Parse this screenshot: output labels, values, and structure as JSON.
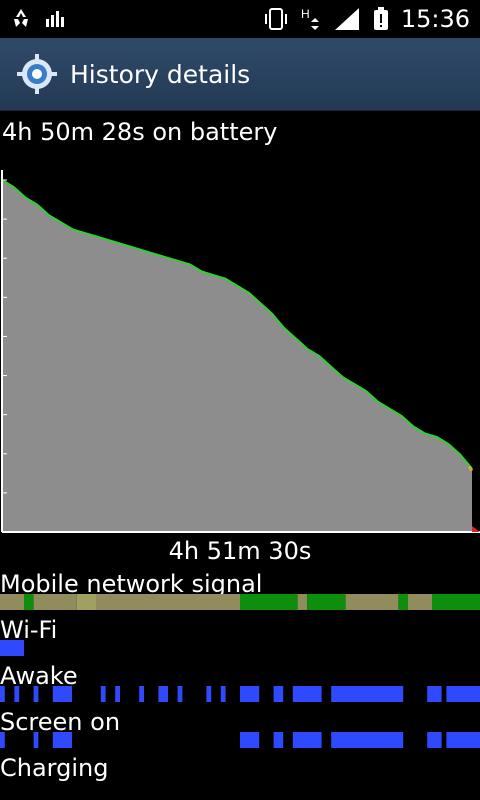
{
  "status_bar": {
    "time": "15:36",
    "left_icons": [
      "recycle-icon",
      "bar-chart-icon"
    ],
    "right_icons": [
      "vibrate-icon",
      "data-h-icon",
      "signal-icon",
      "battery-alert-icon"
    ]
  },
  "title_bar": {
    "icon": "gear-icon",
    "title": "History details"
  },
  "battery": {
    "on_battery": "4h 50m 28s on battery",
    "duration": "4h 51m 30s",
    "level_curve": [
      100,
      98,
      95,
      93,
      90,
      88,
      86,
      85,
      84,
      83,
      82,
      81,
      80,
      79,
      78,
      77,
      76,
      74,
      73,
      72,
      70,
      68,
      65,
      62,
      58,
      55,
      52,
      50,
      47,
      44,
      42,
      40,
      37,
      35,
      33,
      30,
      28,
      27,
      25,
      22,
      18
    ],
    "fill_color": "#8d8d8d",
    "line_color": "#2fd12f",
    "end_color": "#d6b021"
  },
  "rows": [
    {
      "label": "Mobile network signal",
      "type": "signal"
    },
    {
      "label": "Wi-Fi",
      "type": "wifi"
    },
    {
      "label": "Awake",
      "type": "awake"
    },
    {
      "label": "Screen on",
      "type": "screen"
    },
    {
      "label": "Charging",
      "type": "charging"
    }
  ],
  "tracks": {
    "signal": [
      {
        "s": 0.0,
        "e": 0.05,
        "c": "#918c5c"
      },
      {
        "s": 0.05,
        "e": 0.07,
        "c": "#0d8f0d"
      },
      {
        "s": 0.07,
        "e": 0.16,
        "c": "#918c5c"
      },
      {
        "s": 0.16,
        "e": 0.2,
        "c": "#a0a060"
      },
      {
        "s": 0.2,
        "e": 0.5,
        "c": "#918c5c"
      },
      {
        "s": 0.5,
        "e": 0.62,
        "c": "#0d8f0d"
      },
      {
        "s": 0.62,
        "e": 0.64,
        "c": "#918c5c"
      },
      {
        "s": 0.64,
        "e": 0.72,
        "c": "#0d8f0d"
      },
      {
        "s": 0.72,
        "e": 0.83,
        "c": "#918c5c"
      },
      {
        "s": 0.83,
        "e": 0.85,
        "c": "#0d8f0d"
      },
      {
        "s": 0.85,
        "e": 0.9,
        "c": "#918c5c"
      },
      {
        "s": 0.9,
        "e": 1.0,
        "c": "#0d8f0d"
      }
    ],
    "wifi": [
      {
        "s": 0.0,
        "e": 0.05,
        "c": "#2f49ff"
      }
    ],
    "awake": [
      {
        "s": 0.0,
        "e": 0.01,
        "c": "#2f49ff"
      },
      {
        "s": 0.03,
        "e": 0.04,
        "c": "#2f49ff"
      },
      {
        "s": 0.07,
        "e": 0.08,
        "c": "#2f49ff"
      },
      {
        "s": 0.11,
        "e": 0.15,
        "c": "#2f49ff"
      },
      {
        "s": 0.21,
        "e": 0.22,
        "c": "#2f49ff"
      },
      {
        "s": 0.24,
        "e": 0.25,
        "c": "#2f49ff"
      },
      {
        "s": 0.29,
        "e": 0.3,
        "c": "#2f49ff"
      },
      {
        "s": 0.33,
        "e": 0.35,
        "c": "#2f49ff"
      },
      {
        "s": 0.37,
        "e": 0.38,
        "c": "#2f49ff"
      },
      {
        "s": 0.43,
        "e": 0.44,
        "c": "#2f49ff"
      },
      {
        "s": 0.46,
        "e": 0.47,
        "c": "#2f49ff"
      },
      {
        "s": 0.5,
        "e": 0.54,
        "c": "#2f49ff"
      },
      {
        "s": 0.57,
        "e": 0.59,
        "c": "#2f49ff"
      },
      {
        "s": 0.61,
        "e": 0.67,
        "c": "#2f49ff"
      },
      {
        "s": 0.69,
        "e": 0.84,
        "c": "#2f49ff"
      },
      {
        "s": 0.89,
        "e": 0.92,
        "c": "#2f49ff"
      },
      {
        "s": 0.93,
        "e": 1.0,
        "c": "#2f49ff"
      }
    ],
    "screen": [
      {
        "s": 0.0,
        "e": 0.01,
        "c": "#2f49ff"
      },
      {
        "s": 0.07,
        "e": 0.08,
        "c": "#2f49ff"
      },
      {
        "s": 0.11,
        "e": 0.15,
        "c": "#2f49ff"
      },
      {
        "s": 0.5,
        "e": 0.54,
        "c": "#2f49ff"
      },
      {
        "s": 0.57,
        "e": 0.59,
        "c": "#2f49ff"
      },
      {
        "s": 0.61,
        "e": 0.67,
        "c": "#2f49ff"
      },
      {
        "s": 0.69,
        "e": 0.84,
        "c": "#2f49ff"
      },
      {
        "s": 0.89,
        "e": 0.92,
        "c": "#2f49ff"
      },
      {
        "s": 0.93,
        "e": 1.0,
        "c": "#2f49ff"
      }
    ],
    "charging": []
  }
}
